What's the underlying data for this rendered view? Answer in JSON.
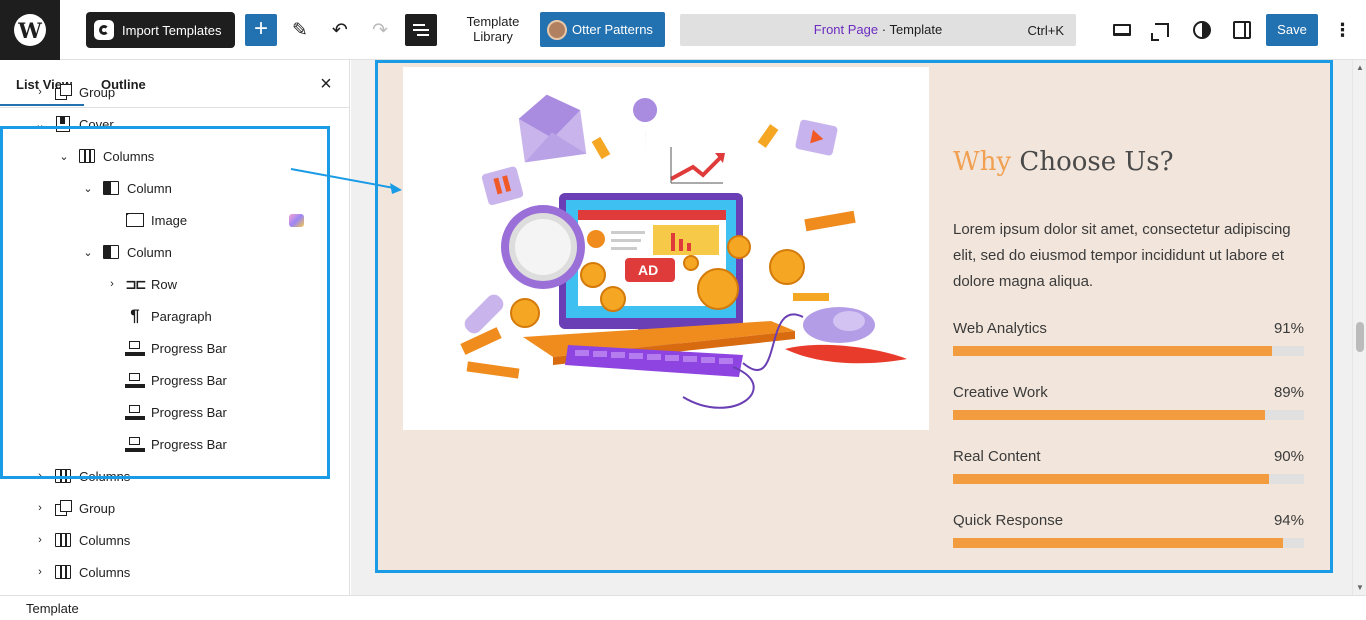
{
  "topbar": {
    "logo_letter": "W",
    "import_label": "Import Templates",
    "add_label": "+",
    "edit_icon": "pencil-icon",
    "undo_icon": "undo-icon",
    "redo_icon": "redo-icon",
    "listview_icon": "list-view-icon",
    "template_library_line1": "Template",
    "template_library_line2": "Library",
    "otter_label": "Otter Patterns",
    "doc_page": "Front Page",
    "doc_sep": " · ",
    "doc_type": "Template",
    "doc_shortcut": "Ctrl+K",
    "save_label": "Save",
    "more_label": "⋮"
  },
  "panel": {
    "tab_list": "List View",
    "tab_outline": "Outline",
    "close_label": "×",
    "items": [
      {
        "label": "Group",
        "icon": "group-icon",
        "chevron": "›"
      },
      {
        "label": "Cover",
        "icon": "cover-icon",
        "chevron": "⌄"
      },
      {
        "label": "Columns",
        "icon": "columns-icon",
        "chevron": "⌄"
      },
      {
        "label": "Column",
        "icon": "column-icon",
        "chevron": "⌄"
      },
      {
        "label": "Image",
        "icon": "image-icon",
        "chevron": ""
      },
      {
        "label": "Column",
        "icon": "column-icon",
        "chevron": "⌄"
      },
      {
        "label": "Row",
        "icon": "row-icon",
        "chevron": "›"
      },
      {
        "label": "Paragraph",
        "icon": "paragraph-icon",
        "chevron": ""
      },
      {
        "label": "Progress Bar",
        "icon": "progress-bar-icon",
        "chevron": ""
      },
      {
        "label": "Progress Bar",
        "icon": "progress-bar-icon",
        "chevron": ""
      },
      {
        "label": "Progress Bar",
        "icon": "progress-bar-icon",
        "chevron": ""
      },
      {
        "label": "Progress Bar",
        "icon": "progress-bar-icon",
        "chevron": ""
      },
      {
        "label": "Columns",
        "icon": "columns-icon",
        "chevron": "›"
      },
      {
        "label": "Group",
        "icon": "group-icon",
        "chevron": "›"
      },
      {
        "label": "Columns",
        "icon": "columns-icon",
        "chevron": "›"
      },
      {
        "label": "Columns",
        "icon": "columns-icon",
        "chevron": "›"
      }
    ]
  },
  "canvas": {
    "heading_accent": "Why",
    "heading_rest": " Choose Us?",
    "paragraph": "Lorem ipsum dolor sit amet, consectetur adipiscing elit, sed do eiusmod tempor incididunt ut labore et dolore magna aliqua.",
    "ad_label": "AD",
    "progress": [
      {
        "label": "Web Analytics",
        "percent_text": "91%",
        "value": 91
      },
      {
        "label": "Creative Work",
        "percent_text": "89%",
        "value": 89
      },
      {
        "label": "Real Content",
        "percent_text": "90%",
        "value": 90
      },
      {
        "label": "Quick Response",
        "percent_text": "94%",
        "value": 94
      }
    ]
  },
  "footer": {
    "breadcrumb": "Template"
  },
  "colors": {
    "accent": "#2271b1",
    "selection": "#1a9be6",
    "progress_fill": "#f29c3f",
    "cover_bg": "#f2e6dc",
    "heading_accent": "#f0a050"
  }
}
